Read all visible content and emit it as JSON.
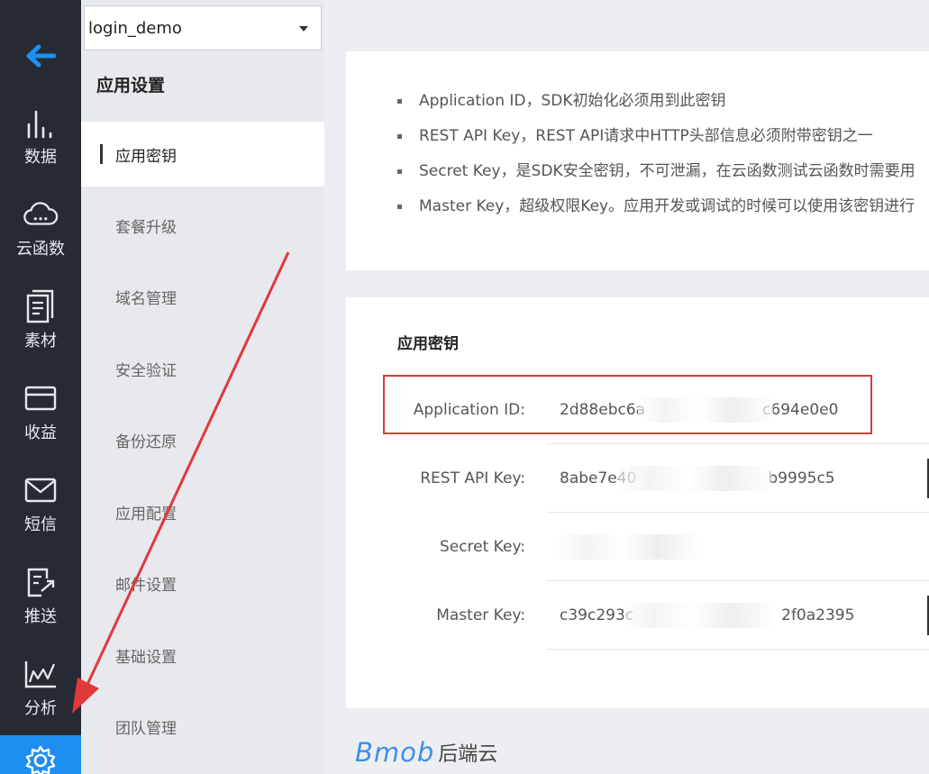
{
  "rail": {
    "items": [
      {
        "label": "数据",
        "icon": "bar-chart-icon"
      },
      {
        "label": "云函数",
        "icon": "cloud-icon"
      },
      {
        "label": "素材",
        "icon": "document-icon"
      },
      {
        "label": "收益",
        "icon": "card-icon"
      },
      {
        "label": "短信",
        "icon": "mail-icon"
      },
      {
        "label": "推送",
        "icon": "push-icon"
      },
      {
        "label": "分析",
        "icon": "line-chart-icon"
      }
    ],
    "active_color": "#1f8ef1"
  },
  "app_selector": {
    "value": "login_demo"
  },
  "submenu": {
    "title": "应用设置",
    "items": [
      {
        "label": "应用密钥",
        "active": true
      },
      {
        "label": "套餐升级"
      },
      {
        "label": "域名管理"
      },
      {
        "label": "安全验证"
      },
      {
        "label": "备份还原"
      },
      {
        "label": "应用配置"
      },
      {
        "label": "邮件设置"
      },
      {
        "label": "基础设置"
      },
      {
        "label": "团队管理"
      }
    ]
  },
  "notes": [
    "Application ID，SDK初始化必须用到此密钥",
    "REST API Key，REST API请求中HTTP头部信息必须附带密钥之一",
    "Secret Key，是SDK安全密钥，不可泄漏，在云函数测试云函数时需要用",
    "Master Key，超级权限Key。应用开发或调试的时候可以使用该密钥进行"
  ],
  "keys": {
    "title": "应用密钥",
    "rows": [
      {
        "label": "Application ID:",
        "value_start": "2d88ebc6a",
        "value_end": "c694e0e0"
      },
      {
        "label": "REST API Key:",
        "value_start": "8abe7e40",
        "value_end": "b9995c5"
      },
      {
        "label": "Secret Key:",
        "value_start": "",
        "value_end": ""
      },
      {
        "label": "Master Key:",
        "value_start": "c39c293c",
        "value_end": "2f0a2395"
      }
    ]
  },
  "brand": {
    "logo": "Bmob",
    "name": "后端云"
  },
  "annotation_color": "#e1383b"
}
